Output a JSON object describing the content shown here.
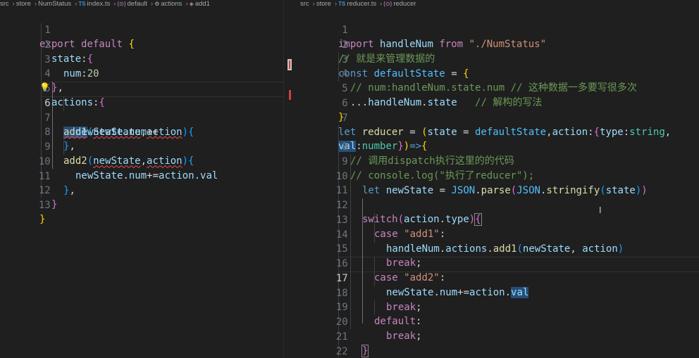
{
  "left_editor": {
    "breadcrumb": [
      "src",
      "store",
      "NumStatus",
      "index.ts",
      "default",
      "actions",
      "add1"
    ],
    "active_line": 6,
    "lines": [
      {
        "n": "1",
        "t": "export default {"
      },
      {
        "n": "2",
        "t": "state:{"
      },
      {
        "n": "3",
        "t": "num:20"
      },
      {
        "n": "4",
        "t": "},"
      },
      {
        "n": "5",
        "t": "actions:{"
      },
      {
        "n": "6",
        "t": "add1(newState,action){"
      },
      {
        "n": "7",
        "t": "newState.num++"
      },
      {
        "n": "8",
        "t": "},"
      },
      {
        "n": "9",
        "t": "add2(newState,action){"
      },
      {
        "n": "10",
        "t": "newState.num+=action.val"
      },
      {
        "n": "11",
        "t": "},"
      },
      {
        "n": "12",
        "t": "}"
      },
      {
        "n": "13",
        "t": "}"
      }
    ]
  },
  "right_editor": {
    "breadcrumb": [
      "src",
      "store",
      "reducer.ts",
      "reducer"
    ],
    "active_line": 17,
    "lines": [
      {
        "n": "1",
        "t": "import handleNum from \"./NumStatus\""
      },
      {
        "n": "2",
        "t": "// 就是来管理数据的"
      },
      {
        "n": "3",
        "t": "const defaultState = {"
      },
      {
        "n": "4",
        "t": "// num:handleNum.state.num // 这种数据一多要写很多次"
      },
      {
        "n": "5",
        "t": "...handleNum.state   // 解构的写法"
      },
      {
        "n": "6",
        "t": "}"
      },
      {
        "n": "7",
        "t": "let reducer = (state = defaultState,action:{type:string,"
      },
      {
        "n": "",
        "t": "val:number})=>{"
      },
      {
        "n": "8",
        "t": "// 调用dispatch执行这里的的代码"
      },
      {
        "n": "9",
        "t": "// console.log(\"执行了reducer\");"
      },
      {
        "n": "10",
        "t": "let newState = JSON.parse(JSON.stringify(state))"
      },
      {
        "n": "11",
        "t": ""
      },
      {
        "n": "12",
        "t": "switch(action.type){"
      },
      {
        "n": "13",
        "t": "case \"add1\":"
      },
      {
        "n": "14",
        "t": "handleNum.actions.add1(newState, action)"
      },
      {
        "n": "15",
        "t": "break;"
      },
      {
        "n": "16",
        "t": "case \"add2\":"
      },
      {
        "n": "17",
        "t": "newState.num+=action.val"
      },
      {
        "n": "18",
        "t": "break;"
      },
      {
        "n": "19",
        "t": "default:"
      },
      {
        "n": "20",
        "t": "break;"
      },
      {
        "n": "21",
        "t": "}"
      },
      {
        "n": "22",
        "t": ""
      },
      {
        "n": "23",
        "t": ""
      }
    ]
  },
  "icons": {
    "ts_file": "TS",
    "symbol_braces": "{⊙}",
    "wrench": "wrench-icon",
    "cube": "cube-icon",
    "lightbulb": "lightbulb-icon"
  },
  "colors": {
    "background": "#1f1f1f",
    "keyword": "#569cd6",
    "control": "#c586c0",
    "function": "#dcdcaa",
    "variable": "#9cdcfe",
    "string": "#ce9178",
    "comment": "#6a9955",
    "error": "#f14c4c"
  }
}
